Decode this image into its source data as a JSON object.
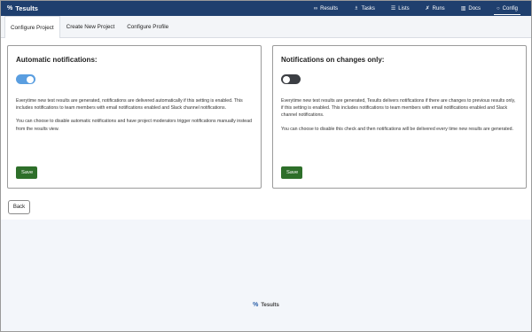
{
  "app": {
    "brand_name": "Tesults",
    "brand_icon": "%"
  },
  "nav": {
    "items": [
      {
        "icon": "∞",
        "label": "Results"
      },
      {
        "icon": "♗",
        "label": "Tasks"
      },
      {
        "icon": "☰",
        "label": "Lists"
      },
      {
        "icon": "✗",
        "label": "Runs"
      },
      {
        "icon": "▥",
        "label": "Docs"
      },
      {
        "icon": "○",
        "label": "Config"
      }
    ]
  },
  "tabs": [
    {
      "label": "Configure Project"
    },
    {
      "label": "Create New Project"
    },
    {
      "label": "Configure Profile"
    }
  ],
  "cards": [
    {
      "title": "Automatic notifications:",
      "toggle_state": "on",
      "paragraph1": "Everytime new test results are generated, notifications are delivered automatically if this setting is enabled. This includes notifications to team members with email notifications enabled and Slack channel notifications.",
      "paragraph2": "You can choose to disable automatic notifications and have project moderators trigger notifications manually instead from the results view.",
      "save_label": "Save"
    },
    {
      "title": "Notifications on changes only:",
      "toggle_state": "off",
      "paragraph1": "Everytime new test results are generated, Tesults delivers notifications if there are changes to previous results only, if this setting is enabled. This includes notifications to team members with email notifications enabled and Slack channel notifications.",
      "paragraph2": "You can choose to disable this check and then notifications will be delivered every time new results are generated.",
      "save_label": "Save"
    }
  ],
  "back_label": "Back",
  "footer": {
    "brand_name": "Tesults",
    "brand_icon": "%"
  },
  "colors": {
    "navbar": "#1f3f6e",
    "toggle_on": "#5a9ee0",
    "toggle_off": "#3c3f44",
    "save_button": "#2e6f2a",
    "footer_bg": "#f3f6fa"
  }
}
